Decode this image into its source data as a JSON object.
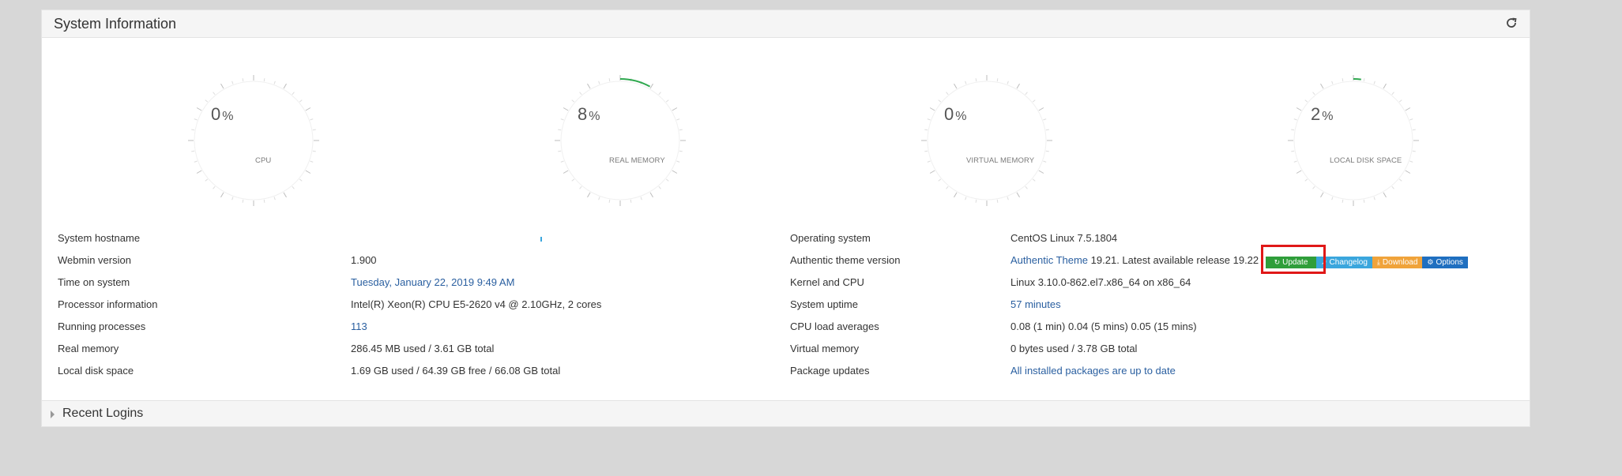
{
  "system_info": {
    "title": "System Information",
    "reload_icon": "refresh-icon"
  },
  "gauges": [
    {
      "value": "0",
      "unit": "%",
      "label": "CPU",
      "fraction": 0.0,
      "color": "#2fa84f"
    },
    {
      "value": "8",
      "unit": "%",
      "label": "REAL MEMORY",
      "fraction": 0.08,
      "color": "#2fa84f"
    },
    {
      "value": "0",
      "unit": "%",
      "label": "VIRTUAL MEMORY",
      "fraction": 0.0,
      "color": "#2fa84f"
    },
    {
      "value": "2",
      "unit": "%",
      "label": "LOCAL DISK SPACE",
      "fraction": 0.02,
      "color": "#2fa84f"
    }
  ],
  "left_rows": [
    {
      "label": "System hostname",
      "value": ""
    },
    {
      "label": "Webmin version",
      "value": "1.900"
    },
    {
      "label": "Time on system",
      "value": "Tuesday, January 22, 2019 9:49 AM"
    },
    {
      "label": "Processor information",
      "value": "Intel(R) Xeon(R) CPU E5-2620 v4 @ 2.10GHz, 2 cores"
    },
    {
      "label": "Running processes",
      "value": "113"
    },
    {
      "label": "Real memory",
      "value": "286.45 MB used / 3.61 GB total"
    },
    {
      "label": "Local disk space",
      "value": "1.69 GB used / 64.39 GB free / 66.08 GB total"
    }
  ],
  "right_rows": [
    {
      "label": "Operating system",
      "value": "CentOS Linux 7.5.1804"
    },
    {
      "label": "Authentic theme version",
      "value_link": "Authentic Theme",
      "value_rest": " 19.21. Latest available release 19.22"
    },
    {
      "label": "Kernel and CPU",
      "value": "Linux 3.10.0-862.el7.x86_64 on x86_64"
    },
    {
      "label": "System uptime",
      "value": "57 minutes"
    },
    {
      "label": "CPU load averages",
      "value": "0.08 (1 min) 0.04 (5 mins) 0.05 (15 mins)"
    },
    {
      "label": "Virtual memory",
      "value": "0 bytes used / 3.78 GB total"
    },
    {
      "label": "Package updates",
      "value": "All installed packages are up to date"
    }
  ],
  "theme_buttons": {
    "update": "Update",
    "changelog": "Changelog",
    "download": "Download",
    "options": "Options"
  },
  "recent_logins": {
    "title": "Recent Logins"
  },
  "colors": {
    "link": "#2a5fa0",
    "highlight": "#e01818",
    "update_btn": "#2f9e3a",
    "changelog_btn": "#3aa6dd",
    "download_btn": "#f0a33a",
    "options_btn": "#1f6fc0"
  }
}
